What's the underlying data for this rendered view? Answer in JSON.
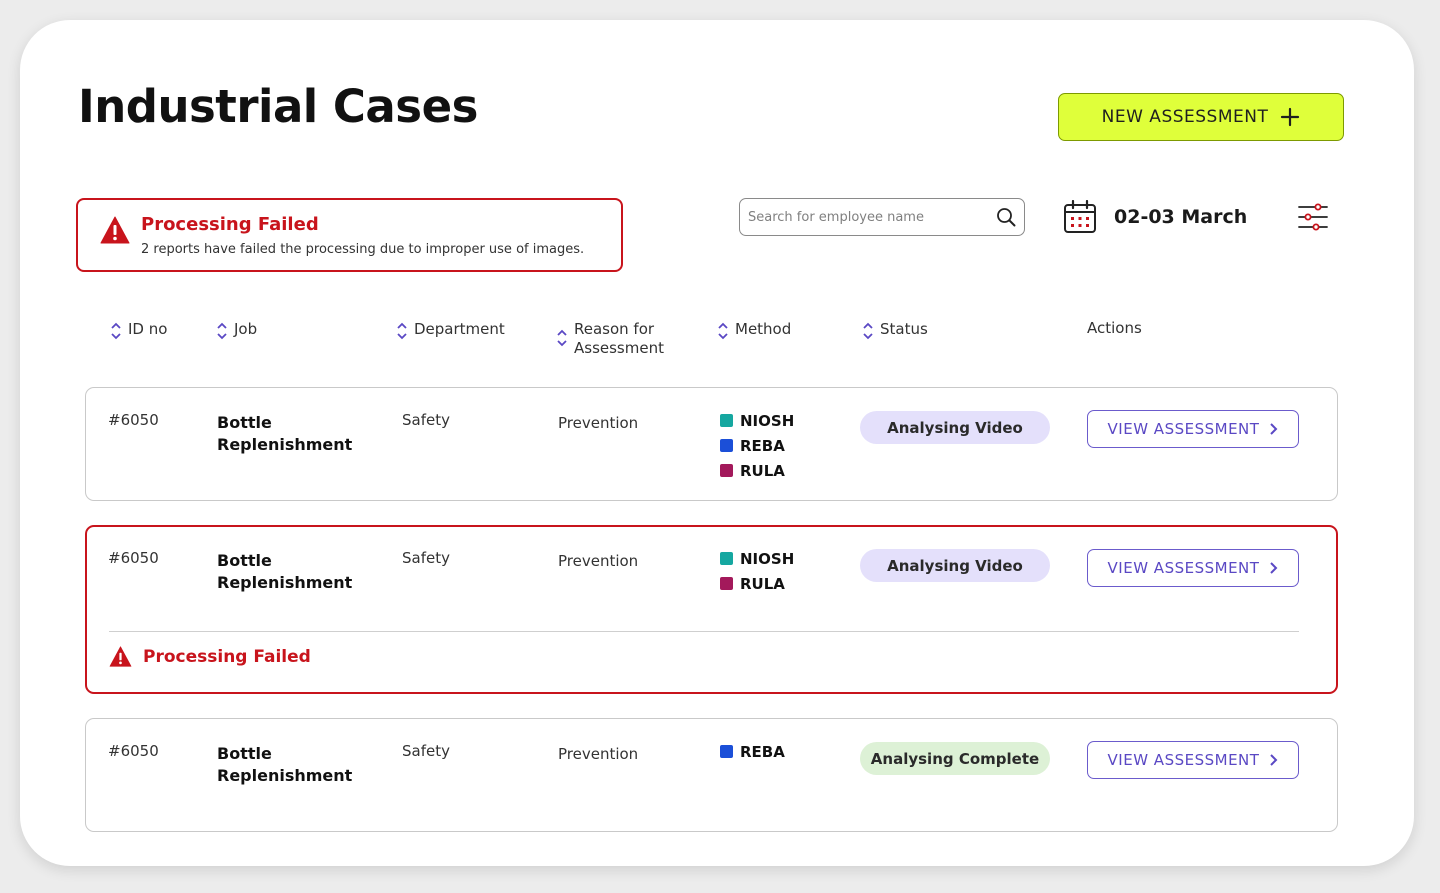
{
  "page": {
    "title": "Industrial Cases",
    "new_assessment_label": "NEW ASSESSMENT"
  },
  "alert": {
    "title": "Processing Failed",
    "message": "2 reports have failed the processing due to improper use of images."
  },
  "search": {
    "placeholder": "Search for employee name"
  },
  "date_range": "02-03 March",
  "columns": {
    "id": "ID no",
    "job": "Job",
    "department": "Department",
    "reason_line1": "Reason for",
    "reason_line2": "Assessment",
    "method": "Method",
    "status": "Status",
    "actions": "Actions"
  },
  "colors": {
    "NIOSH": "#15a7a0",
    "REBA": "#1b4fd8",
    "RULA": "#a3195b",
    "analysing_bg": "#e4e0fb",
    "complete_bg": "#ddf1d6",
    "danger": "#c8141c",
    "accent_button": "#dfff3a"
  },
  "rows": [
    {
      "id": "#6050",
      "job_line1": "Bottle",
      "job_line2": "Replenishment",
      "department": "Safety",
      "reason": "Prevention",
      "methods": [
        "NIOSH",
        "REBA",
        "RULA"
      ],
      "status": "Analysing Video",
      "status_type": "analysing",
      "action": "VIEW ASSESSMENT"
    },
    {
      "id": "#6050",
      "job_line1": "Bottle",
      "job_line2": "Replenishment",
      "department": "Safety",
      "reason": "Prevention",
      "methods": [
        "NIOSH",
        "RULA"
      ],
      "status": "Analysing Video",
      "status_type": "analysing",
      "action": "VIEW ASSESSMENT",
      "error": "Processing Failed"
    },
    {
      "id": "#6050",
      "job_line1": "Bottle",
      "job_line2": "Replenishment",
      "department": "Safety",
      "reason": "Prevention",
      "methods": [
        "REBA"
      ],
      "status": "Analysing Complete",
      "status_type": "complete",
      "action": "VIEW ASSESSMENT"
    }
  ]
}
